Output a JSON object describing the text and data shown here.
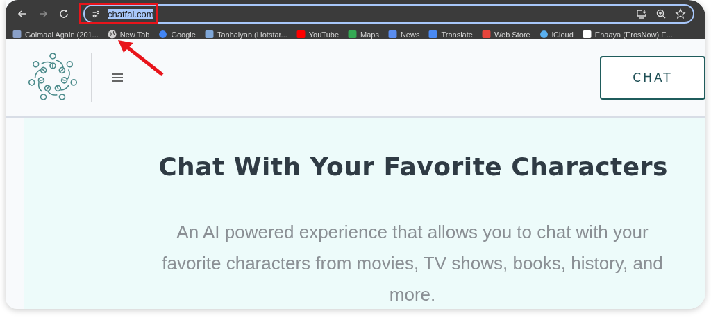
{
  "browser": {
    "url": "chatfai.com",
    "url_selected": true,
    "bookmarks": [
      {
        "label": "Golmaal Again (201...",
        "kind": "film"
      },
      {
        "label": "New Tab",
        "kind": "globe"
      },
      {
        "label": "Google",
        "kind": "google"
      },
      {
        "label": "Tanhaiyan (Hotstar...",
        "kind": "doc"
      },
      {
        "label": "YouTube",
        "kind": "youtube"
      },
      {
        "label": "Maps",
        "kind": "maps"
      },
      {
        "label": "News",
        "kind": "news"
      },
      {
        "label": "Translate",
        "kind": "translate"
      },
      {
        "label": "Web Store",
        "kind": "store"
      },
      {
        "label": "iCloud",
        "kind": "cloud"
      },
      {
        "label": "Enaaya (ErosNow) E...",
        "kind": "blank"
      }
    ]
  },
  "header": {
    "button": "CHAT"
  },
  "hero": {
    "title": "Chat With Your Favorite Characters",
    "subtitle": "An AI powered experience that allows you to chat with your favorite characters from movies, TV shows, books, history, and more."
  }
}
